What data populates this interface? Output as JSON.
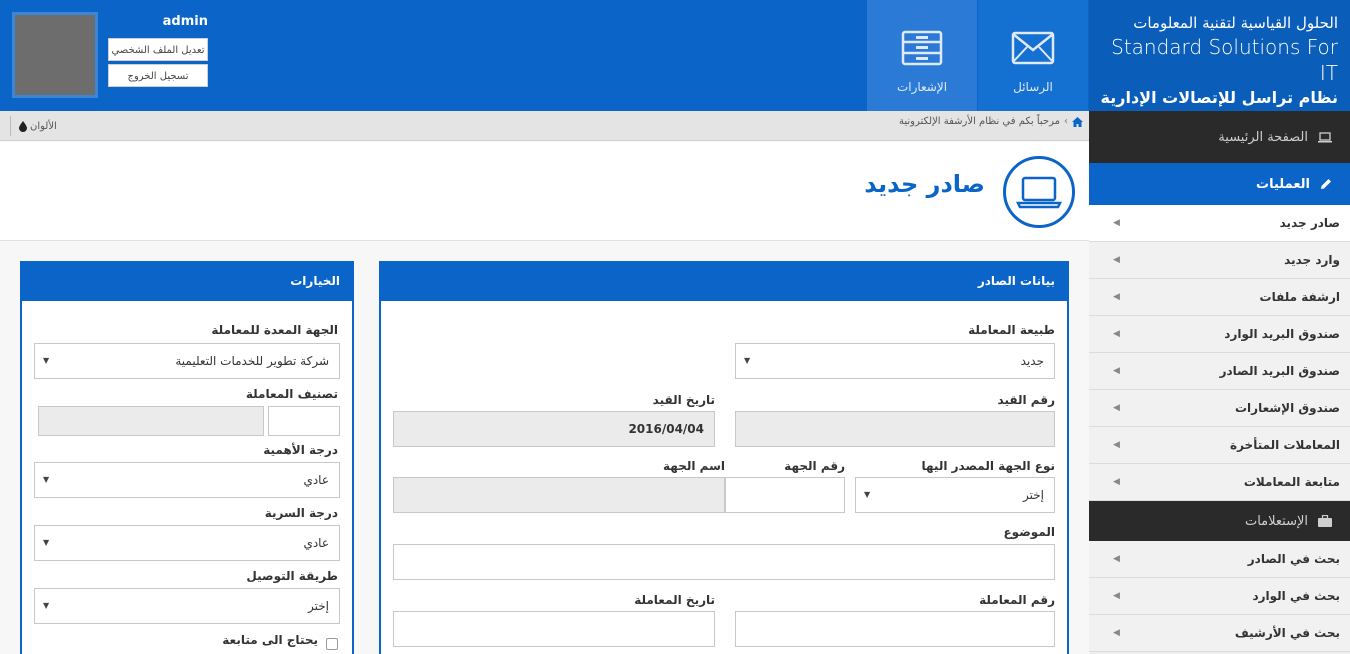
{
  "header": {
    "brand_line1": "الحلول القياسية لتقنية المعلومات",
    "brand_line2": "Standard Solutions For IT",
    "brand_line3": "نظام تراسل للإتصالات الإدارية",
    "nav_messages": "الرسائل",
    "nav_notifications": "الإشعارات",
    "user_name": "admin",
    "edit_profile": "تعديل الملف الشخصي",
    "logout": "تسجيل الخروج"
  },
  "breadcrumb": {
    "text": "مرحباً بكم في نظام الأرشفة الإلكترونية",
    "colors_label": "الألوان"
  },
  "page": {
    "title": "صادر جديد"
  },
  "sidebar": {
    "home": "الصفحة الرئيسية",
    "operations": "العمليات",
    "items": [
      "صادر جديد",
      "وارد جديد",
      "ارشفة ملفات",
      "صندوق البريد الوارد",
      "صندوق البريد الصادر",
      "صندوق الإشعارات",
      "المعاملات المتأخرة",
      "متابعة المعاملات"
    ],
    "queries": "الإستعلامات",
    "query_items": [
      "بحث في الصادر",
      "بحث في الوارد",
      "بحث في الأرشيف"
    ]
  },
  "main_panel": {
    "title": "بيانات الصادر",
    "transaction_type_label": "طبيعة المعاملة",
    "transaction_type_value": "جديد",
    "record_number_label": "رقم القيد",
    "record_date_label": "تاريخ القيد",
    "record_date_value": "2016/04/04",
    "entity_type_label": "نوع الجهة المصدر اليها",
    "entity_type_value": "إختر",
    "entity_number_label": "رقم الجهة",
    "entity_name_label": "اسم الجهة",
    "subject_label": "الموضوع",
    "transaction_number_label": "رقم المعاملة",
    "transaction_date_label": "تاريخ المعاملة"
  },
  "options_panel": {
    "title": "الخيارات",
    "preparing_entity_label": "الجهة المعدة للمعاملة",
    "preparing_entity_value": "شركة تطوير للخدمات التعليمية",
    "classification_label": "تصنيف المعاملة",
    "importance_label": "درجة الأهمية",
    "importance_value": "عادي",
    "confidentiality_label": "درجة السرية",
    "confidentiality_value": "عادي",
    "delivery_label": "طريقة التوصيل",
    "delivery_value": "إختر",
    "followup_label": "يحتاج الى متابعة"
  },
  "colors": {
    "primary": "#0b65c8",
    "dark": "#2a2a2a"
  },
  "icons": [
    "envelope-icon",
    "cabinet-icon",
    "laptop-icon",
    "home-icon",
    "pencil-icon",
    "briefcase-icon",
    "drop-icon"
  ]
}
